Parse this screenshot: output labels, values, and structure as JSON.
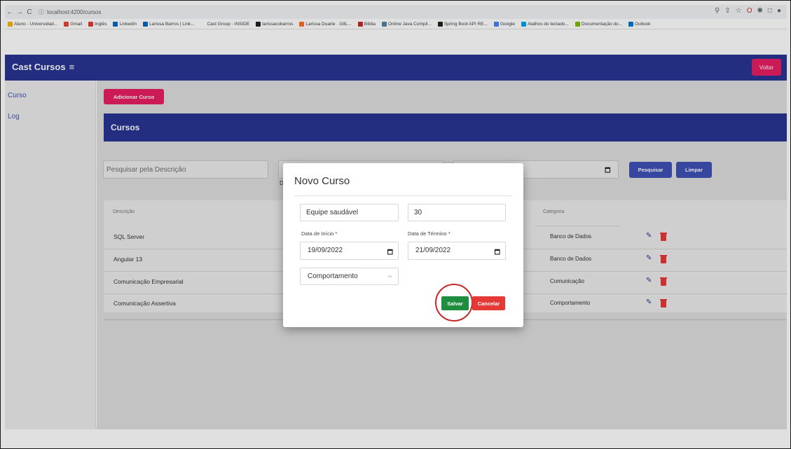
{
  "browser": {
    "url": "localhost:4200/cursos",
    "bookmarks": [
      {
        "label": "Aluno - Universidad...",
        "icon": "university-icon",
        "color": "#f4b400"
      },
      {
        "label": "Gmail",
        "icon": "gmail-icon",
        "color": "#ea4335"
      },
      {
        "label": "Inglês",
        "icon": "language-icon",
        "color": "#e53935"
      },
      {
        "label": "LinkedIn",
        "icon": "linkedin-icon",
        "color": "#0a66c2"
      },
      {
        "label": "Larissa Barros | Link...",
        "icon": "linkedin-icon",
        "color": "#0a66c2"
      },
      {
        "label": "Cast Group - INSIDE",
        "icon": "blank-icon",
        "color": "#ffffff"
      },
      {
        "label": "larissacobarros",
        "icon": "github-icon",
        "color": "#222222"
      },
      {
        "label": "Larissa Duarte · GitL...",
        "icon": "gitlab-icon",
        "color": "#fc6d26"
      },
      {
        "label": "Bíblia",
        "icon": "bible-icon",
        "color": "#c62828"
      },
      {
        "label": "Online Java Compil...",
        "icon": "java-icon",
        "color": "#5382a1"
      },
      {
        "label": "Spring Boot API RE...",
        "icon": "spring-icon",
        "color": "#222222"
      },
      {
        "label": "Google",
        "icon": "google-icon",
        "color": "#4285f4"
      },
      {
        "label": "Atalhos do teclado...",
        "icon": "windows-icon",
        "color": "#00a4ef"
      },
      {
        "label": "Documentação do...",
        "icon": "windows-icon",
        "color": "#7fba00"
      },
      {
        "label": "Outlook",
        "icon": "outlook-icon",
        "color": "#0078d4"
      }
    ]
  },
  "app": {
    "title": "Cast Cursos",
    "menu_icon": "≡",
    "voltar_label": "Voltar",
    "primary_color": "#283593",
    "accent_color": "#e91e63"
  },
  "sidebar": {
    "items": [
      {
        "label": "Curso"
      },
      {
        "label": "Log"
      }
    ]
  },
  "main": {
    "add_button": "Adicionar Curso",
    "header_title": "Cursos",
    "search_placeholder": "Pesquisar pela Descrição",
    "mid_label_letter": "D",
    "pesquisar_label": "Pesquisar",
    "limpar_label": "Limpar"
  },
  "table": {
    "col_descricao": "Descrição",
    "col_categoria": "Categoria",
    "rows": [
      {
        "descricao": "SQL Server",
        "categoria": "Banco de Dados"
      },
      {
        "descricao": "Angular 13",
        "categoria": "Banco de Dados"
      },
      {
        "descricao": "Comunicação Empresarial",
        "categoria": "Comunicação"
      },
      {
        "descricao": "Comunicação Assertiva",
        "categoria": "Comportamento"
      }
    ]
  },
  "modal": {
    "title": "Novo Curso",
    "descricao_value": "Equipe saudável",
    "carga_value": "30",
    "data_inicio_label": "Data de Início *",
    "data_inicio_value": "19/09/2022",
    "data_termino_label": "Data de Término *",
    "data_termino_value": "21/09/2022",
    "categoria_value": "Comportamento",
    "salvar_label": "Salvar",
    "cancelar_label": "Cancelar"
  }
}
